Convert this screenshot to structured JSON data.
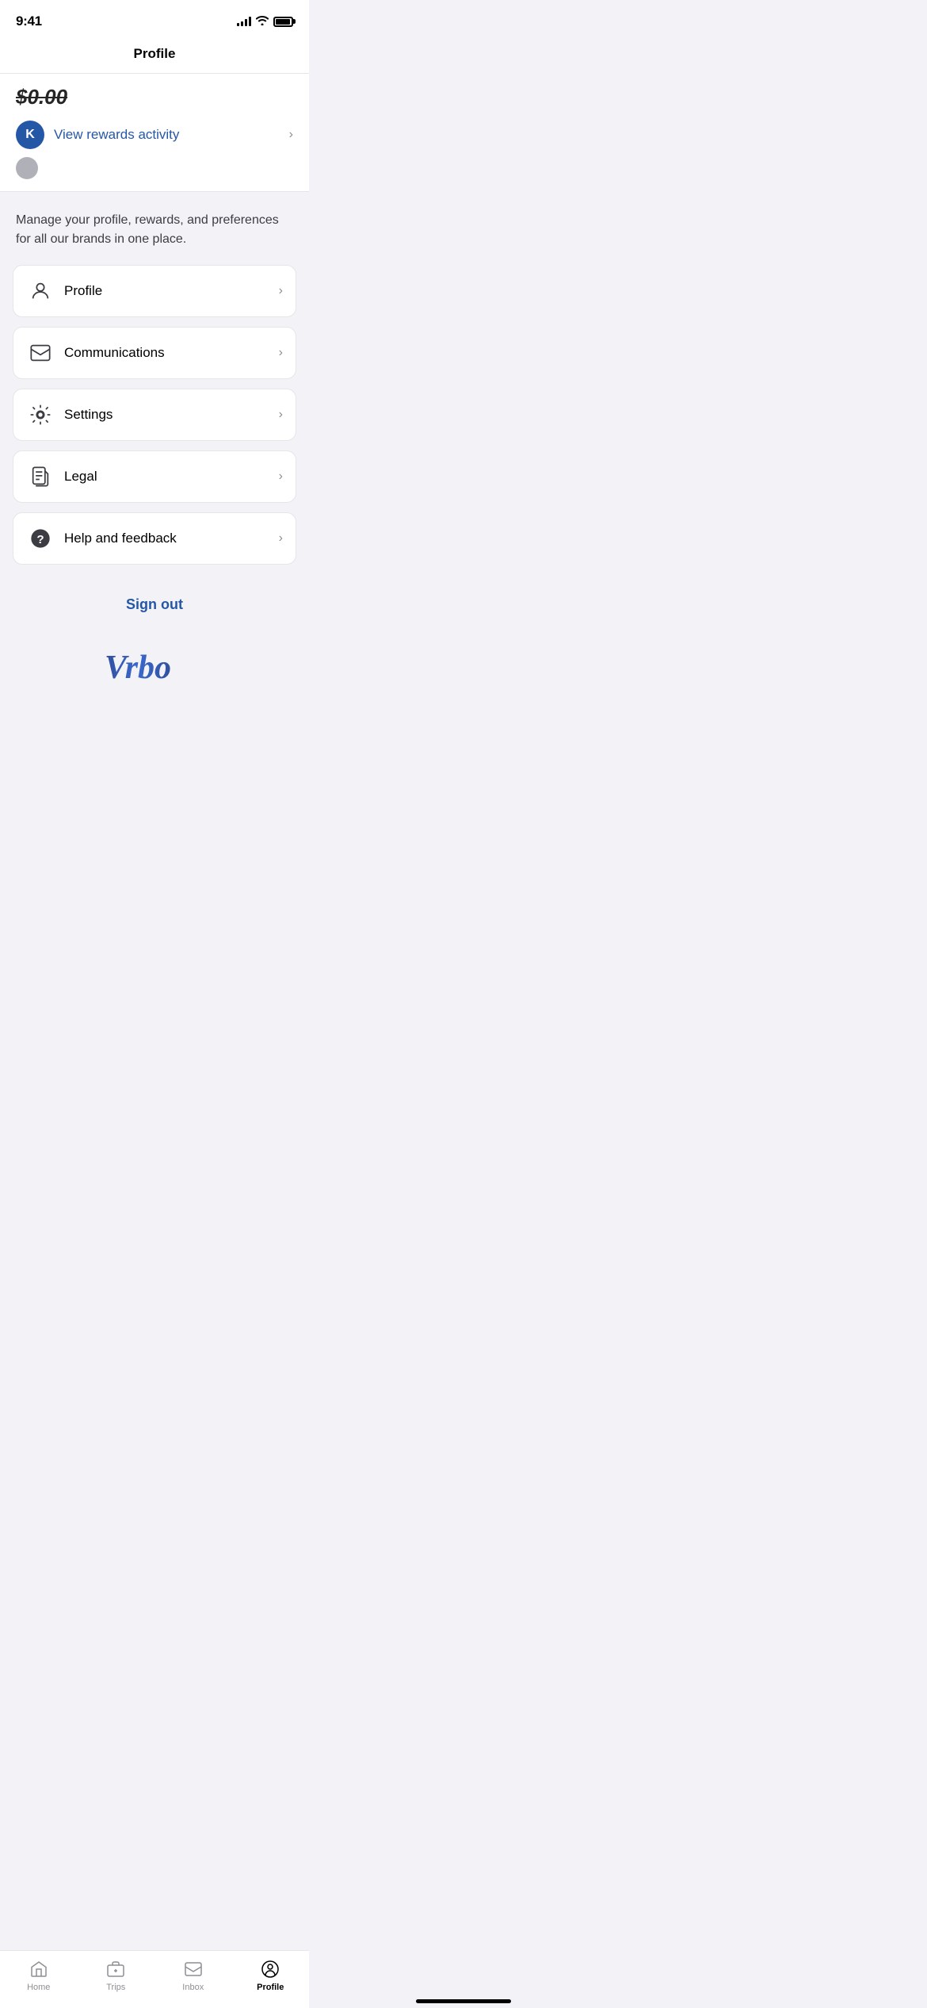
{
  "statusBar": {
    "time": "9:41"
  },
  "header": {
    "title": "Profile"
  },
  "topSection": {
    "balance": "$0.00",
    "rewardsAvatar": "K",
    "rewardsLinkText": "View rewards activity"
  },
  "description": {
    "text": "Manage your profile, rewards, and preferences for all our brands in one place."
  },
  "menuItems": [
    {
      "id": "profile",
      "label": "Profile",
      "icon": "person"
    },
    {
      "id": "communications",
      "label": "Communications",
      "icon": "envelope"
    },
    {
      "id": "settings",
      "label": "Settings",
      "icon": "gear"
    },
    {
      "id": "legal",
      "label": "Legal",
      "icon": "document"
    },
    {
      "id": "help",
      "label": "Help and feedback",
      "icon": "question"
    }
  ],
  "signOut": {
    "label": "Sign out"
  },
  "tabBar": {
    "items": [
      {
        "id": "home",
        "label": "Home",
        "active": false
      },
      {
        "id": "trips",
        "label": "Trips",
        "active": false
      },
      {
        "id": "inbox",
        "label": "Inbox",
        "active": false
      },
      {
        "id": "profile",
        "label": "Profile",
        "active": true
      }
    ]
  }
}
